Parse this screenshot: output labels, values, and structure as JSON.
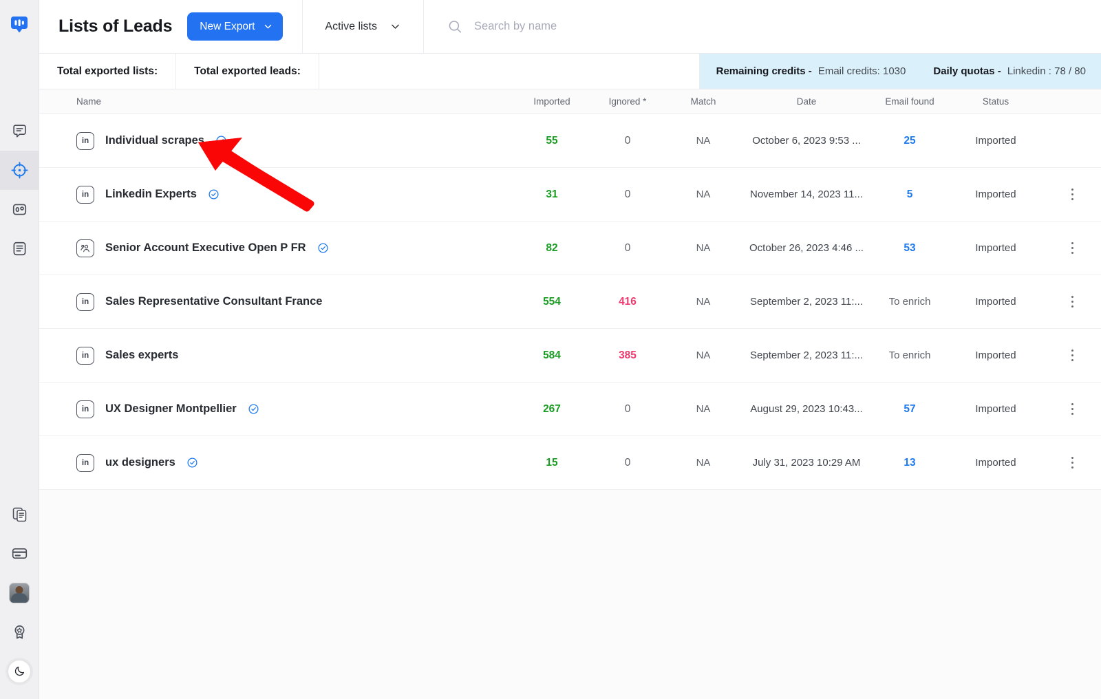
{
  "app": {
    "logo_icon": "speech-bubble-logo",
    "accent_color": "#2272f2",
    "banner_color": "#daf0fb",
    "positive_color": "#1a9c23",
    "negative_color": "#f0396e",
    "link_color": "#1f7aec"
  },
  "sidebar": {
    "top_items": [
      {
        "icon": "message-icon",
        "active": false
      },
      {
        "icon": "target-crosshair-icon",
        "active": true
      },
      {
        "icon": "counter-box-icon",
        "active": false
      },
      {
        "icon": "document-list-icon",
        "active": false
      }
    ],
    "bottom_items": [
      {
        "icon": "copy-documents-icon"
      },
      {
        "icon": "credit-card-icon"
      },
      {
        "icon": "avatar"
      },
      {
        "icon": "award-badge-icon"
      },
      {
        "icon": "moon-icon"
      }
    ]
  },
  "header": {
    "title": "Lists of Leads",
    "new_export_label": "New Export",
    "new_export_chevron": "chevron-down-icon",
    "filter_label": "Active lists",
    "filter_chevron": "chevron-down-icon",
    "search_icon": "search-icon",
    "search_placeholder": "Search by name",
    "search_value": ""
  },
  "stats": {
    "total_lists_label": "Total exported lists:",
    "total_lists_value": "",
    "total_leads_label": "Total exported leads:",
    "total_leads_value": "",
    "credits": [
      {
        "label": "Remaining credits -",
        "value": "Email credits: 1030"
      },
      {
        "label": "Daily quotas -",
        "value": "Linkedin : 78 / 80"
      }
    ]
  },
  "table": {
    "columns": [
      "Name",
      "Imported",
      "Ignored *",
      "Match",
      "Date",
      "Email found",
      "Status"
    ],
    "rows": [
      {
        "source_icon": "linkedin-icon",
        "source_label": "in",
        "name": "Individual scrapes",
        "verified": true,
        "imported": "55",
        "imported_kind": "green",
        "ignored": "0",
        "ignored_kind": "zero",
        "match": "NA",
        "date": "October 6, 2023 9:53 ...",
        "email_found": "25",
        "email_kind": "link",
        "status": "Imported",
        "menu": false
      },
      {
        "source_icon": "linkedin-icon",
        "source_label": "in",
        "name": "Linkedin Experts",
        "verified": true,
        "imported": "31",
        "imported_kind": "green",
        "ignored": "0",
        "ignored_kind": "zero",
        "match": "NA",
        "date": "November 14, 2023 11...",
        "email_found": "5",
        "email_kind": "link",
        "status": "Imported",
        "menu": true
      },
      {
        "source_icon": "people-group-icon",
        "source_label": "",
        "name": "Senior Account Executive Open P FR",
        "verified": true,
        "imported": "82",
        "imported_kind": "green",
        "ignored": "0",
        "ignored_kind": "zero",
        "match": "NA",
        "date": "October 26, 2023 4:46 ...",
        "email_found": "53",
        "email_kind": "link",
        "status": "Imported",
        "menu": true
      },
      {
        "source_icon": "linkedin-icon",
        "source_label": "in",
        "name": "Sales Representative Consultant France",
        "verified": false,
        "imported": "554",
        "imported_kind": "green",
        "ignored": "416",
        "ignored_kind": "pink",
        "match": "NA",
        "date": "September 2, 2023 11:...",
        "email_found": "To enrich",
        "email_kind": "muted",
        "status": "Imported",
        "menu": true
      },
      {
        "source_icon": "linkedin-icon",
        "source_label": "in",
        "name": "Sales experts",
        "verified": false,
        "imported": "584",
        "imported_kind": "green",
        "ignored": "385",
        "ignored_kind": "pink",
        "match": "NA",
        "date": "September 2, 2023 11:...",
        "email_found": "To enrich",
        "email_kind": "muted",
        "status": "Imported",
        "menu": true
      },
      {
        "source_icon": "linkedin-icon",
        "source_label": "in",
        "name": "UX Designer Montpellier",
        "verified": true,
        "imported": "267",
        "imported_kind": "green",
        "ignored": "0",
        "ignored_kind": "zero",
        "match": "NA",
        "date": "August 29, 2023 10:43...",
        "email_found": "57",
        "email_kind": "link",
        "status": "Imported",
        "menu": true
      },
      {
        "source_icon": "linkedin-icon",
        "source_label": "in",
        "name": "ux designers",
        "verified": true,
        "imported": "15",
        "imported_kind": "green",
        "ignored": "0",
        "ignored_kind": "zero",
        "match": "NA",
        "date": "July 31, 2023 10:29 AM",
        "email_found": "13",
        "email_kind": "link",
        "status": "Imported",
        "menu": true
      }
    ]
  },
  "annotation": {
    "type": "arrow",
    "color": "#fb0606",
    "points_to": "Individual scrapes"
  }
}
